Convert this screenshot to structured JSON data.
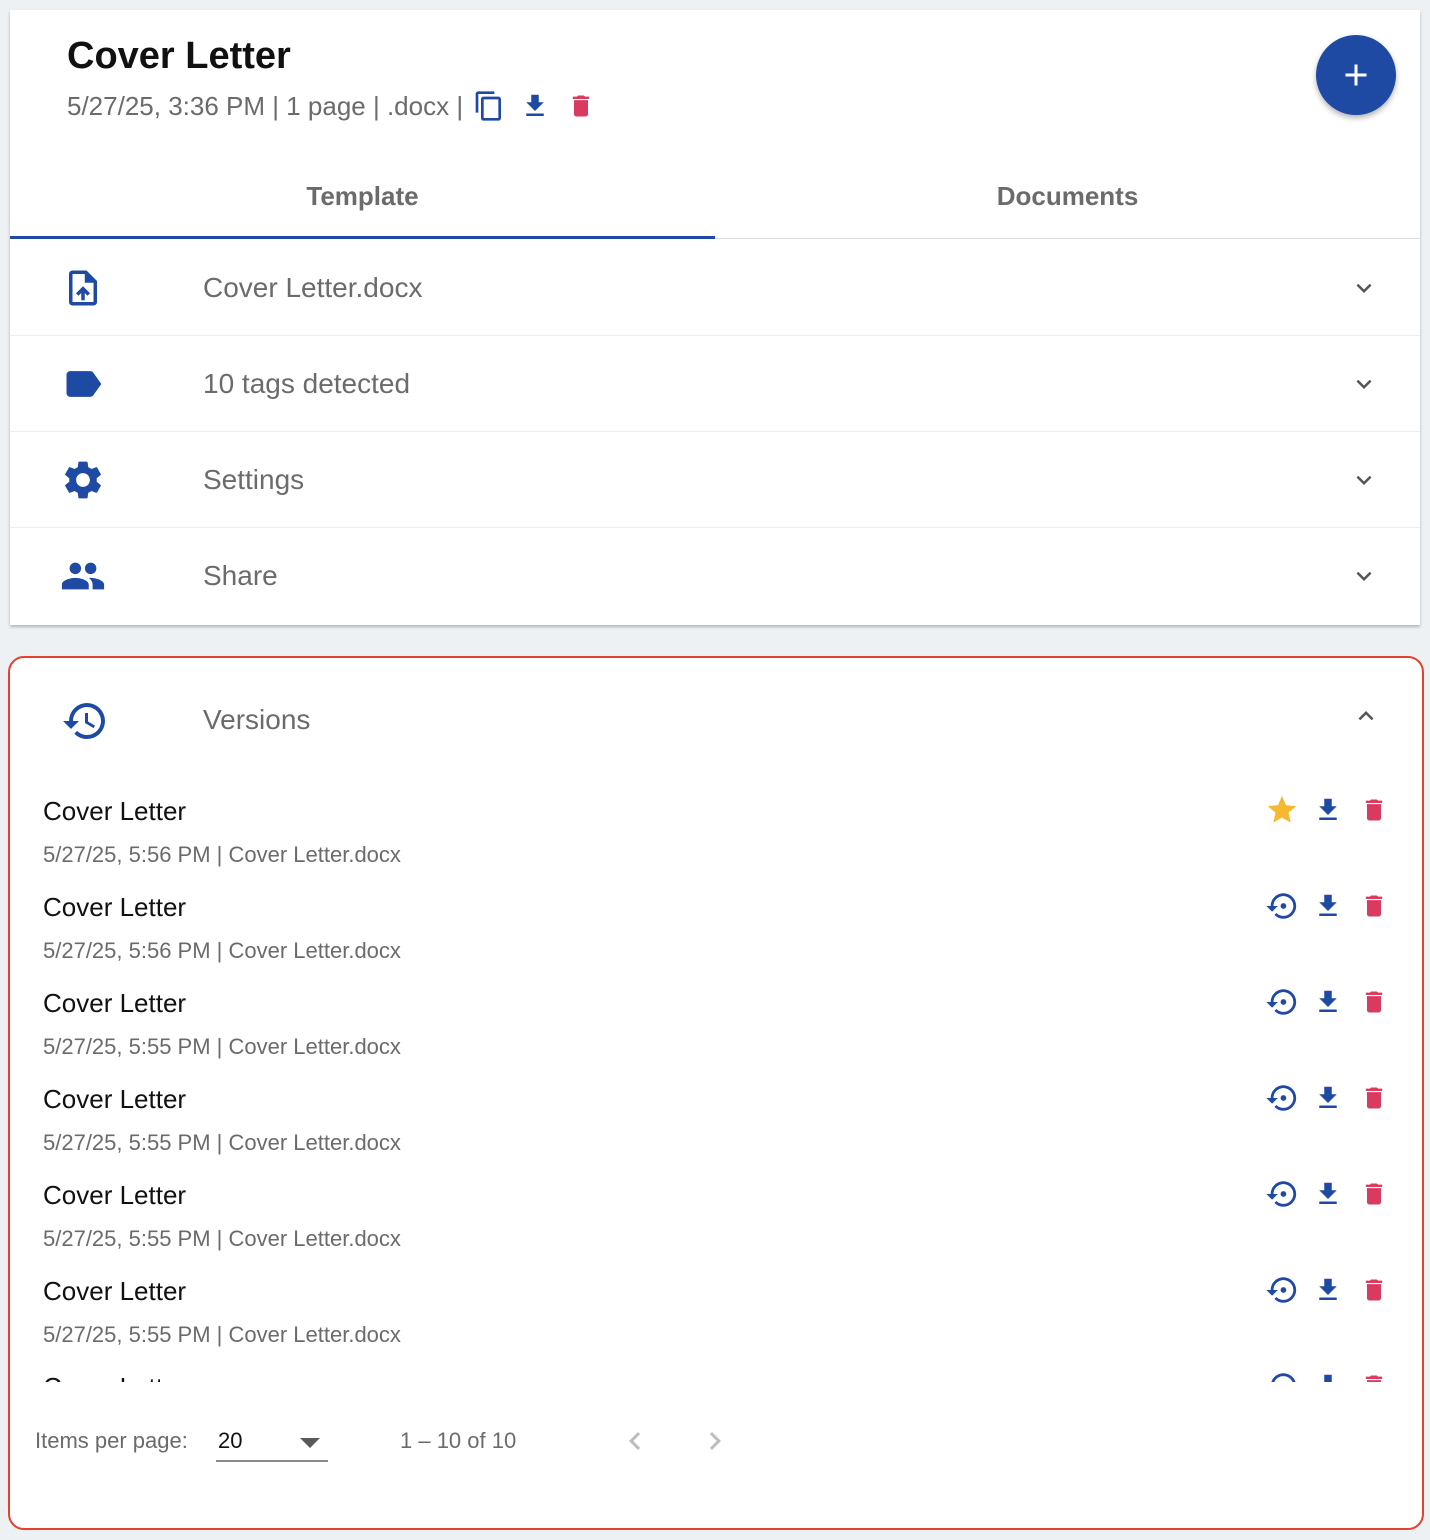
{
  "header": {
    "title": "Cover Letter",
    "meta": "5/27/25, 3:36 PM | 1 page | .docx |",
    "icons": [
      "copy-icon",
      "download-icon",
      "delete-icon"
    ],
    "fab_icon": "plus-icon"
  },
  "tabs": [
    {
      "label": "Template",
      "active": true
    },
    {
      "label": "Documents",
      "active": false
    }
  ],
  "panels": [
    {
      "label": "Cover Letter.docx",
      "icon": "file-upload-icon"
    },
    {
      "label": "10 tags detected",
      "icon": "tag-icon"
    },
    {
      "label": "Settings",
      "icon": "gear-icon"
    },
    {
      "label": "Share",
      "icon": "people-icon"
    }
  ],
  "versions": {
    "label": "Versions",
    "icon": "history-icon",
    "items": [
      {
        "title": "Cover Letter",
        "meta": "5/27/25, 5:56 PM | Cover Letter.docx",
        "primary_action": "star-icon"
      },
      {
        "title": "Cover Letter",
        "meta": "5/27/25, 5:56 PM | Cover Letter.docx",
        "primary_action": "restore-icon"
      },
      {
        "title": "Cover Letter",
        "meta": "5/27/25, 5:55 PM | Cover Letter.docx",
        "primary_action": "restore-icon"
      },
      {
        "title": "Cover Letter",
        "meta": "5/27/25, 5:55 PM | Cover Letter.docx",
        "primary_action": "restore-icon"
      },
      {
        "title": "Cover Letter",
        "meta": "5/27/25, 5:55 PM | Cover Letter.docx",
        "primary_action": "restore-icon"
      },
      {
        "title": "Cover Letter",
        "meta": "5/27/25, 5:55 PM | Cover Letter.docx",
        "primary_action": "restore-icon"
      },
      {
        "title": "Cover Letter",
        "meta": "",
        "primary_action": "restore-icon"
      }
    ],
    "paginator": {
      "items_per_page_label": "Items per page:",
      "page_size": "20",
      "range": "1 – 10 of 10"
    }
  },
  "colors": {
    "primary": "#1e4aa3",
    "delete": "#d93a5f",
    "star": "#f5b82e",
    "highlight_border": "#e2432f"
  }
}
